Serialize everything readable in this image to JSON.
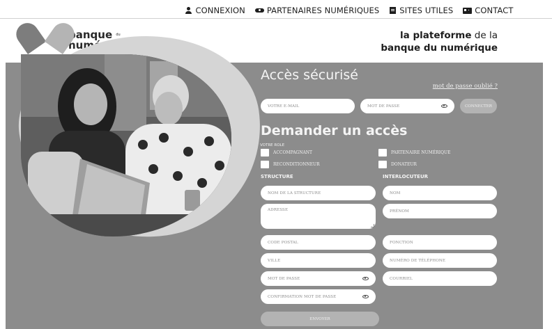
{
  "nav": {
    "items": [
      {
        "label": "CONNEXION",
        "icon": "user-icon"
      },
      {
        "label": "PARTENAIRES NUMÉRIQUES",
        "icon": "handshake-icon"
      },
      {
        "label": "SITES UTILES",
        "icon": "book-icon"
      },
      {
        "label": "CONTACT",
        "icon": "id-card-icon"
      }
    ]
  },
  "logo": {
    "line1": "banque",
    "du": "du",
    "line2": "numérique"
  },
  "tagline": {
    "line1_bold": "la plateforme",
    "line1_rest": " de la",
    "line2": "banque du numérique"
  },
  "login": {
    "title": "Accès sécurisé",
    "forgot": "mot de passe oublié ?",
    "email_placeholder": "VOTRE E-MAIL",
    "password_placeholder": "MOT DE PASSE",
    "connect": "CONNECTER"
  },
  "request": {
    "title": "Demander un accès",
    "role_label": "VOTRE ROLE",
    "roles": [
      "ACCOMPAGNANT",
      "PARTENAIRE NUMÉRIQUE",
      "RECONDITIONNEUR",
      "DONATEUR"
    ],
    "structure_title": "STRUCTURE",
    "contact_title": "INTERLOCUTEUR",
    "structure_fields": {
      "name": "NOM DE LA STRUCTURE",
      "address": "ADRESSE",
      "postal": "CODE POSTAL",
      "city": "VILLE",
      "password": "MOT DE PASSE",
      "confirm": "CONFIRMATION MOT DE PASSE"
    },
    "contact_fields": {
      "lastname": "NOM",
      "firstname": "PRÉNOM",
      "function": "FONCTION",
      "phone": "NUMÉRO DE TÉLÉPHONE",
      "email": "COURRIEL"
    },
    "submit": "ENVOYER"
  }
}
